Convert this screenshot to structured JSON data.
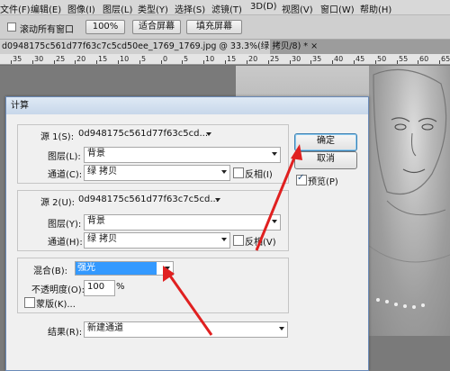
{
  "menubar": {
    "items": [
      "文件(F)",
      "编辑(E)",
      "图像(I)",
      "图层(L)",
      "类型(Y)",
      "选择(S)",
      "滤镜(T)",
      "3D(D)",
      "视图(V)",
      "窗口(W)",
      "帮助(H)"
    ]
  },
  "options": {
    "resize_all_windows": "滚动所有窗口",
    "zoom_100": "100%",
    "fit_screen": "适合屏幕",
    "fill_screen": "填充屏幕"
  },
  "document": {
    "tab_title": "d0948175c561d77f63c7c5cd50ee_1769_1769.jpg @ 33.3%(绿 拷贝/8) * ×"
  },
  "ruler": {
    "ticks": [
      "35",
      "30",
      "25",
      "20",
      "15",
      "10",
      "5",
      "0",
      "5",
      "10",
      "15",
      "20",
      "25",
      "30",
      "35",
      "40",
      "45",
      "50",
      "55",
      "60",
      "65"
    ]
  },
  "dialog": {
    "title": "计算",
    "source1": {
      "label": "源 1(S):",
      "file": "0d948175c561d77f63c5cd...",
      "layer_label": "图层(L):",
      "layer_value": "背景",
      "channel_label": "通道(C):",
      "channel_value": "绿 拷贝",
      "invert_label": "反相(I)"
    },
    "source2": {
      "label": "源 2(U):",
      "file": "0d948175c561d77f63c7c5cd...",
      "layer_label": "图层(Y):",
      "layer_value": "背景",
      "channel_label": "通道(H):",
      "channel_value": "绿 拷贝",
      "invert_label": "反相(V)"
    },
    "blend": {
      "label": "混合(B):",
      "value": "强光",
      "opacity_label": "不透明度(O):",
      "opacity_value": "100",
      "opacity_unit": "%",
      "mask_label": "蒙版(K)..."
    },
    "result": {
      "label": "结果(R):",
      "value": "新建通道"
    },
    "buttons": {
      "ok": "确定",
      "cancel": "取消",
      "preview": "预览(P)"
    }
  },
  "colors": {
    "selection_highlight": "#3399ff",
    "arrow": "#e02020"
  }
}
